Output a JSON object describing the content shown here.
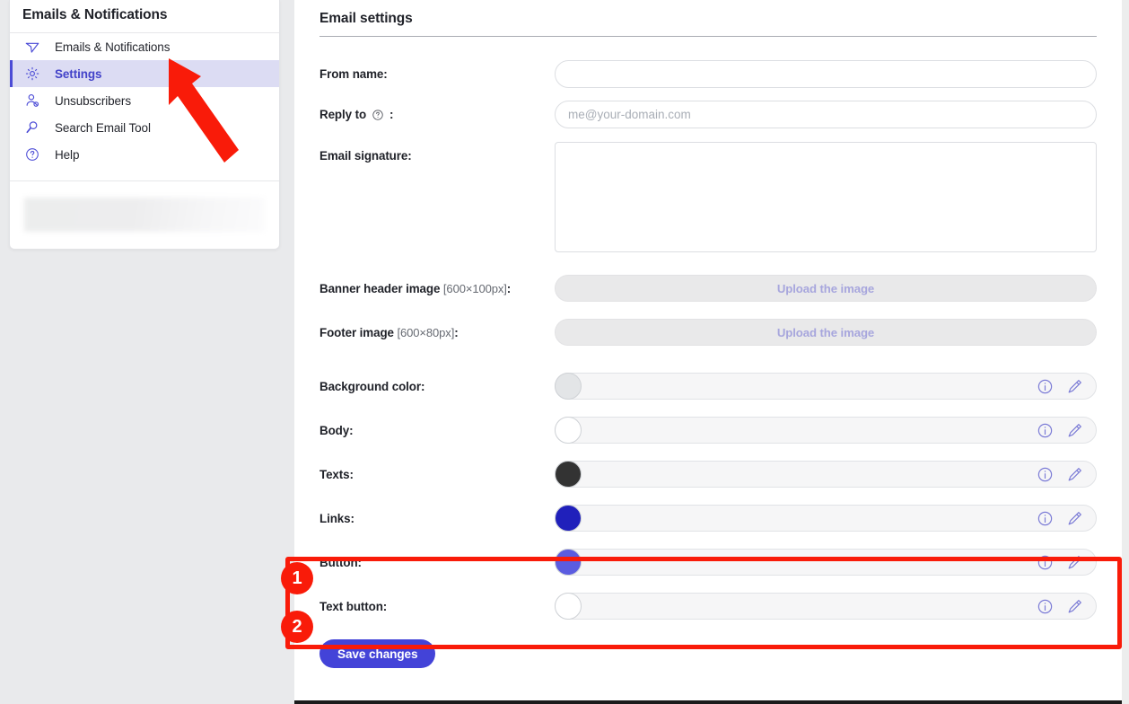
{
  "sidebar": {
    "title": "Emails & Notifications",
    "items": [
      {
        "label": "Emails & Notifications",
        "icon": "send-icon",
        "active": false
      },
      {
        "label": "Settings",
        "icon": "gear-icon",
        "active": true
      },
      {
        "label": "Unsubscribers",
        "icon": "user-remove-icon",
        "active": false
      },
      {
        "label": "Search Email Tool",
        "icon": "magnifier-icon",
        "active": false
      },
      {
        "label": "Help",
        "icon": "question-circle-icon",
        "active": false
      }
    ]
  },
  "main": {
    "page_title": "Email settings",
    "fields": {
      "from_name": {
        "label": "From name:",
        "value": "",
        "placeholder": ""
      },
      "reply_to": {
        "label": "Reply to",
        "suffix": ":",
        "help_icon": "question-circle-icon",
        "value": "",
        "placeholder": "me@your-domain.com"
      },
      "email_signature": {
        "label": "Email signature:",
        "value": "",
        "placeholder": ""
      },
      "banner_header_image": {
        "label": "Banner header image",
        "dimensions": "[600×100px]",
        "suffix": ":",
        "button_label": "Upload the image"
      },
      "footer_image": {
        "label": "Footer image",
        "dimensions": "[600×80px]",
        "suffix": ":",
        "button_label": "Upload the image"
      }
    },
    "colors": [
      {
        "label": "Background color:",
        "value": "#e3e5e7",
        "highlighted": false
      },
      {
        "label": "Body:",
        "value": "#ffffff",
        "highlighted": false
      },
      {
        "label": "Texts:",
        "value": "#333333",
        "highlighted": false
      },
      {
        "label": "Links:",
        "value": "#2020bb",
        "highlighted": false
      },
      {
        "label": "Button:",
        "value": "#5b5ce0",
        "highlighted": true
      },
      {
        "label": "Text button:",
        "value": "#ffffff",
        "highlighted": true
      }
    ],
    "color_row_icons": {
      "info": "info-circle-icon",
      "edit": "pencil-icon"
    },
    "save_label": "Save changes"
  },
  "annotations": {
    "badges": [
      "1",
      "2"
    ],
    "box_color": "#f91b09",
    "arrow_color": "#f91b09",
    "arrow_target": "Settings"
  },
  "theme": {
    "accent": "#4343d8",
    "sidebar_active_bg": "#dcdcf3",
    "sidebar_active_text": "#4343c9",
    "page_bg": "#e9eaec",
    "annotation_red": "#f91b09"
  }
}
